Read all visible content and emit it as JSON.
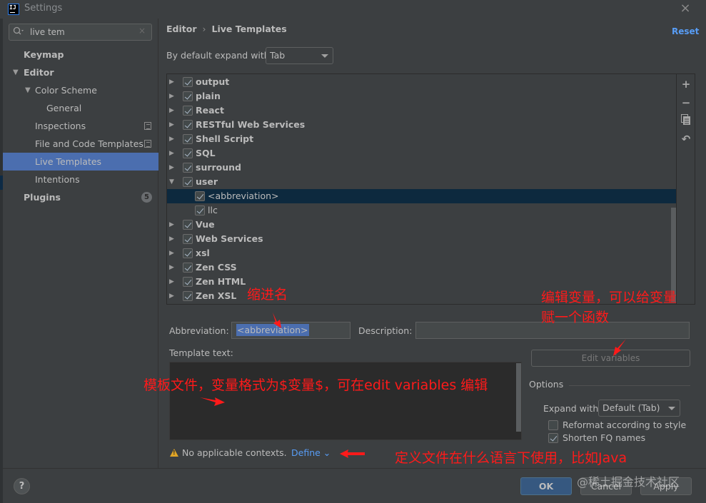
{
  "window": {
    "title": "Settings",
    "app_icon_text": "IJ",
    "close_icon": "×"
  },
  "sidebar": {
    "search": {
      "value": "live tem",
      "icon": "search-icon",
      "clear_icon": "×"
    },
    "items": [
      {
        "label": "Keymap",
        "bold": true,
        "level": 0
      },
      {
        "label": "Editor",
        "bold": true,
        "level": 0,
        "expanded": true
      },
      {
        "label": "Color Scheme",
        "level": 1,
        "expanded": true
      },
      {
        "label": "General",
        "level": 2
      },
      {
        "label": "Inspections",
        "level": 1,
        "has_project_icon": true
      },
      {
        "label": "File and Code Templates",
        "level": 1,
        "has_project_icon": true
      },
      {
        "label": "Live Templates",
        "level": 1,
        "selected": true
      },
      {
        "label": "Intentions",
        "level": 1
      },
      {
        "label": "Plugins",
        "bold": true,
        "level": 0,
        "badge": "5"
      }
    ]
  },
  "header": {
    "breadcrumb": [
      "Editor",
      "Live Templates"
    ],
    "breadcrumb_sep": "›",
    "reset_label": "Reset"
  },
  "expand_default": {
    "label": "By default expand with",
    "value": "Tab"
  },
  "tree": {
    "rows": [
      {
        "label": "output",
        "group": true,
        "checked": true,
        "expanded": false
      },
      {
        "label": "plain",
        "group": true,
        "checked": true,
        "expanded": false
      },
      {
        "label": "React",
        "group": true,
        "checked": true,
        "expanded": false
      },
      {
        "label": "RESTful Web Services",
        "group": true,
        "checked": true,
        "expanded": false
      },
      {
        "label": "Shell Script",
        "group": true,
        "checked": true,
        "expanded": false
      },
      {
        "label": "SQL",
        "group": true,
        "checked": true,
        "expanded": false
      },
      {
        "label": "surround",
        "group": true,
        "checked": true,
        "expanded": false
      },
      {
        "label": "user",
        "group": true,
        "checked": true,
        "expanded": true
      },
      {
        "label": "<abbreviation>",
        "group": false,
        "checked": true,
        "selected": true
      },
      {
        "label": "llc",
        "group": false,
        "checked": true
      },
      {
        "label": "Vue",
        "group": true,
        "checked": true,
        "expanded": false
      },
      {
        "label": "Web Services",
        "group": true,
        "checked": true,
        "expanded": false
      },
      {
        "label": "xsl",
        "group": true,
        "checked": true,
        "expanded": false
      },
      {
        "label": "Zen CSS",
        "group": true,
        "checked": true,
        "expanded": false
      },
      {
        "label": "Zen HTML",
        "group": true,
        "checked": true,
        "expanded": false
      },
      {
        "label": "Zen XSL",
        "group": true,
        "checked": true,
        "expanded": false
      }
    ],
    "toolbar": {
      "add_icon": "+",
      "remove_icon": "−",
      "copy_icon": "⧉",
      "restore_icon": "↶"
    }
  },
  "form": {
    "abbreviation_label": "Abbreviation:",
    "abbreviation_value": "<abbreviation>",
    "description_label": "Description:",
    "description_value": "",
    "template_text_label": "Template text:",
    "template_text_value": "",
    "edit_variables_label": "Edit variables"
  },
  "options": {
    "title": "Options",
    "expand_with_label": "Expand with",
    "expand_with_value": "Default (Tab)",
    "reformat_label": "Reformat according to style",
    "reformat_checked": false,
    "shorten_label": "Shorten FQ names",
    "shorten_checked": true
  },
  "contexts": {
    "warning_text": "No applicable contexts.",
    "define_label": "Define ⌄"
  },
  "footer": {
    "help_label": "?",
    "ok_label": "OK",
    "cancel_label": "Cancel",
    "apply_label": "Apply"
  },
  "annotations": {
    "abbreviation_note": "缩进名",
    "edit_vars_note_line1": "编辑变量，可以给变量",
    "edit_vars_note_line2": "赋一个函数",
    "template_note": "模板文件，变量格式为$变量$，可在edit variables 编辑",
    "context_note": "定义文件在什么语言下使用，比如Java",
    "color": "#ff1a1a"
  },
  "watermark": "@稀土掘金技术社区"
}
